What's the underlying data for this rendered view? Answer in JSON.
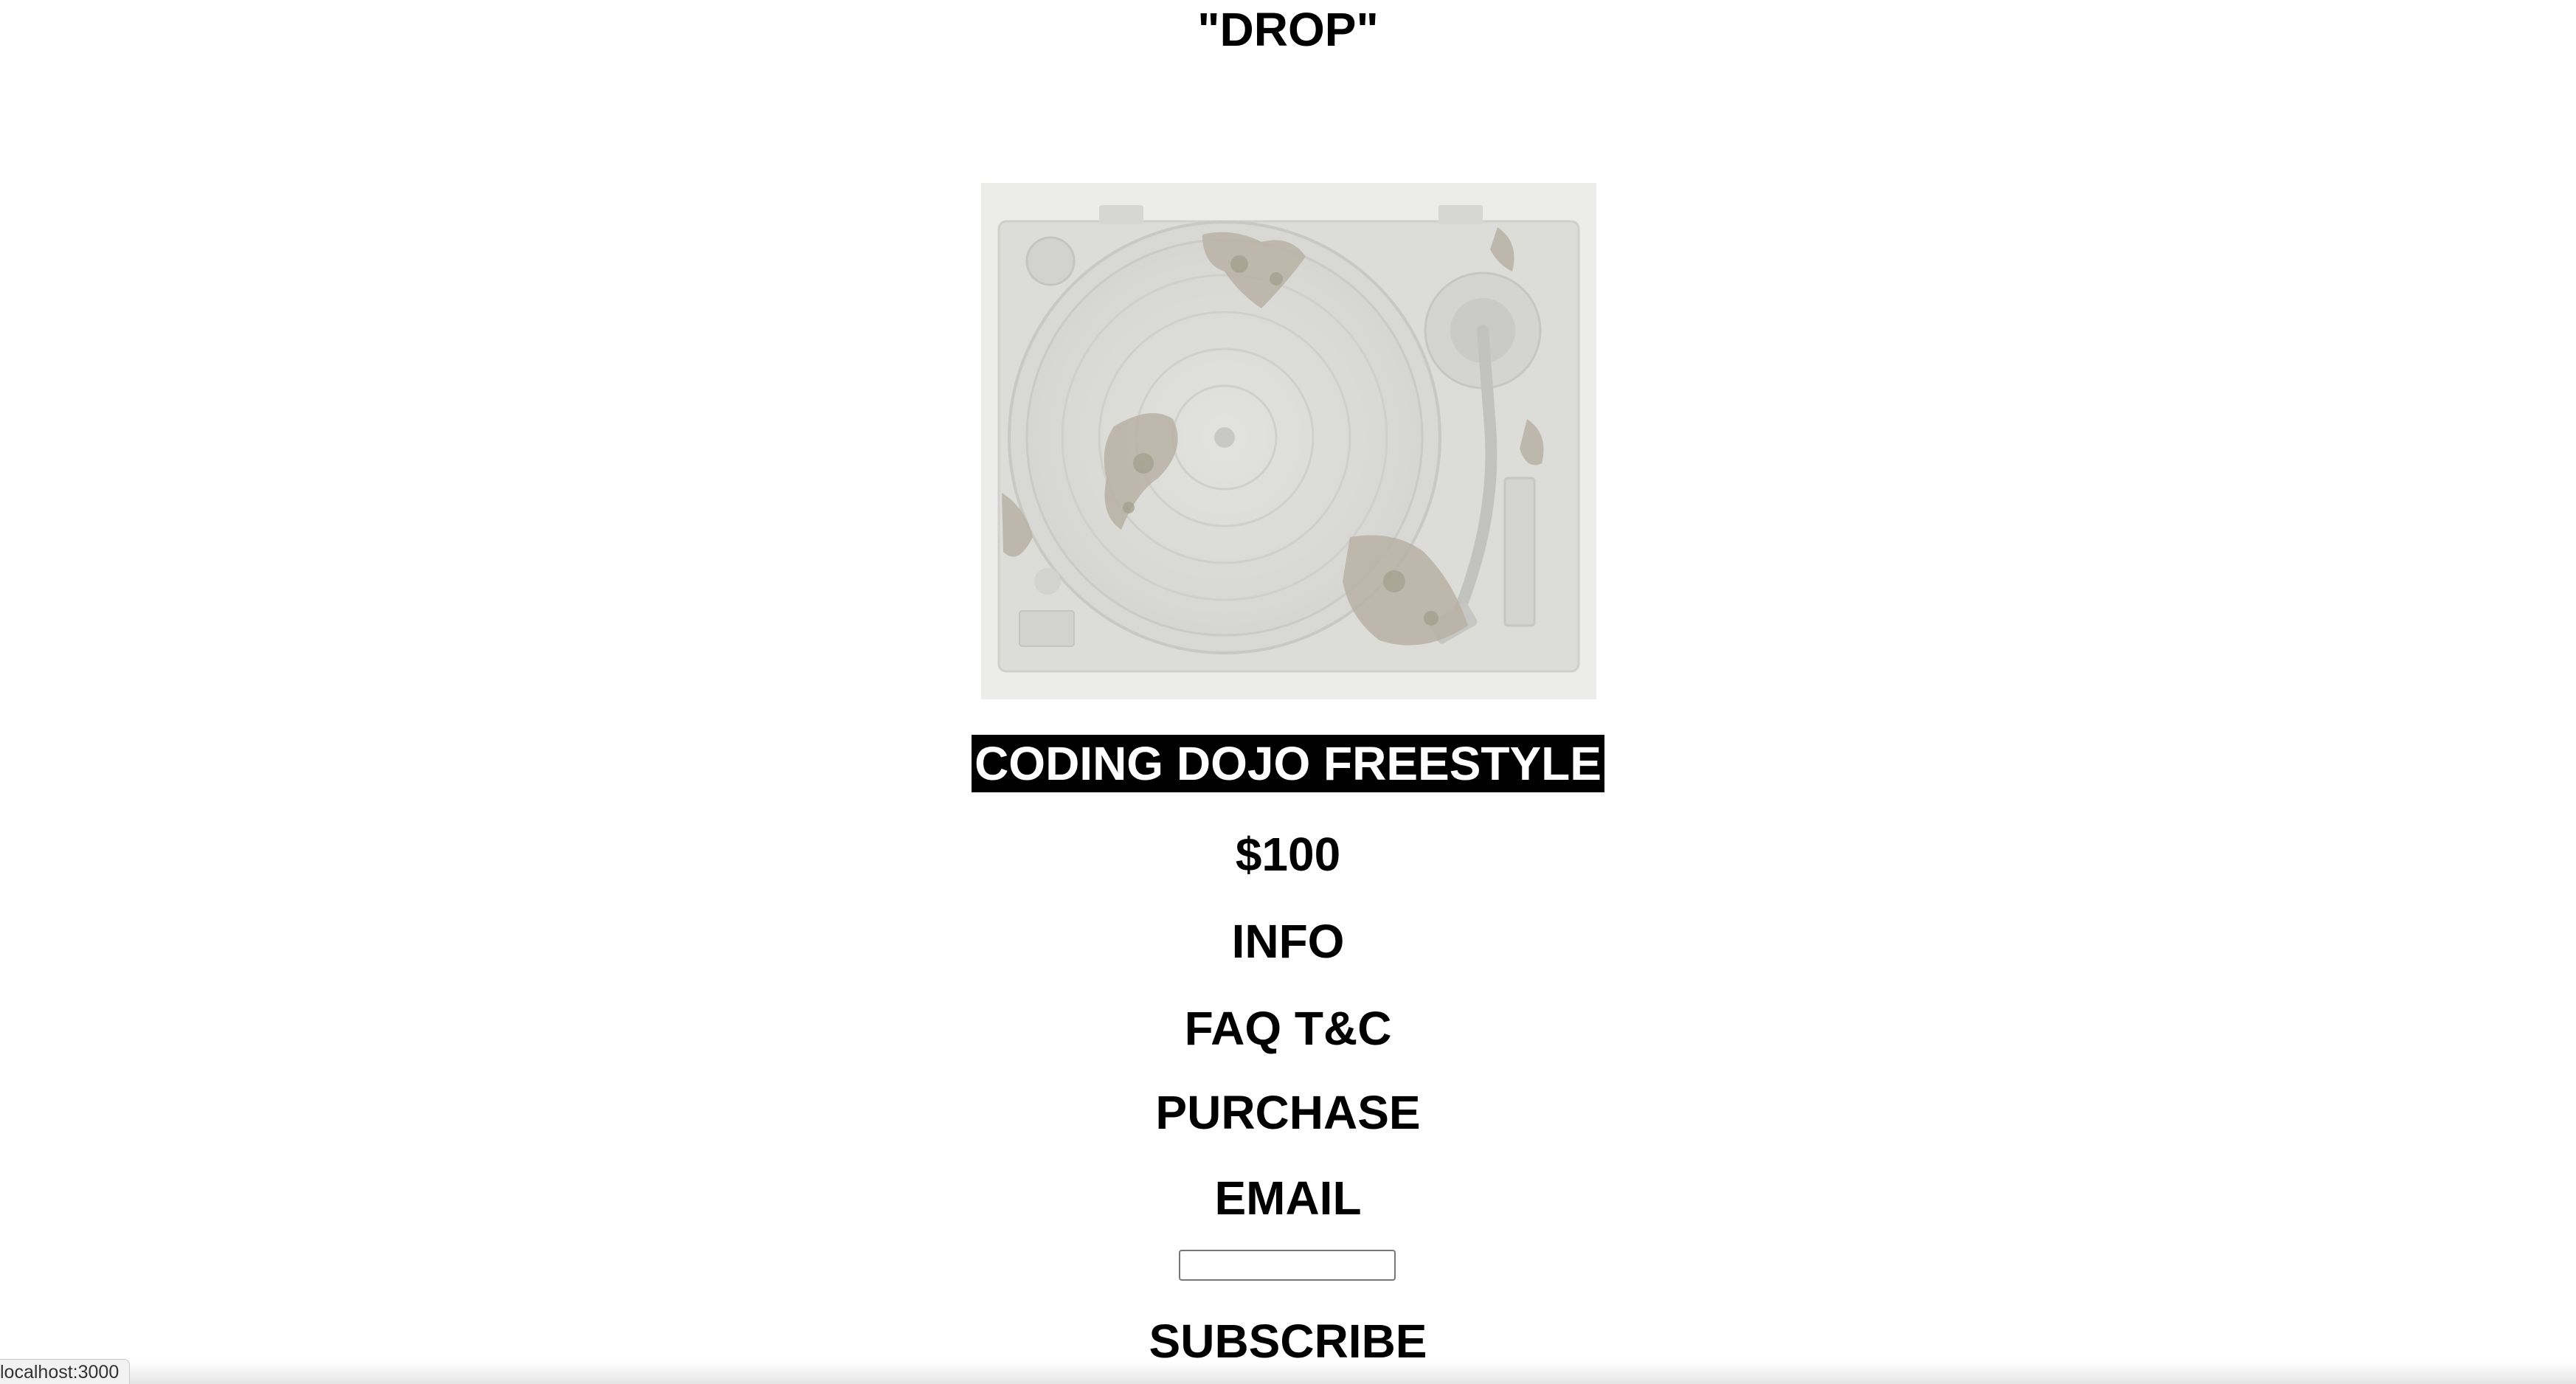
{
  "page": {
    "title": "\"DROP\""
  },
  "product": {
    "image_alt": "Turntable sculpture",
    "name": "CODING DOJO FREESTYLE",
    "price": "$100"
  },
  "links": {
    "info": "INFO",
    "faq": "FAQ T&C",
    "purchase": "PURCHASE"
  },
  "subscribe": {
    "email_label": "EMAIL",
    "email_value": "",
    "button_label": "SUBSCRIBE"
  },
  "status_bar": {
    "url": "localhost:3000"
  },
  "colors": {
    "background": "#ffffff",
    "text": "#000000",
    "highlight_bg": "#000000",
    "highlight_text": "#ffffff",
    "image_bg": "#ececea"
  }
}
